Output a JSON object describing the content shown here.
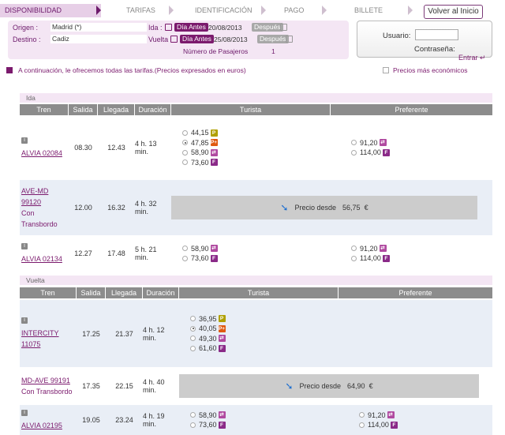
{
  "steps": [
    {
      "label": "DISPONIBILIDAD",
      "active": true
    },
    {
      "label": "TARIFAS",
      "active": false
    },
    {
      "label": "IDENTIFICACIÓN",
      "active": false
    },
    {
      "label": "PAGO",
      "active": false
    },
    {
      "label": "BILLETE",
      "active": false
    }
  ],
  "volver_label": "Volver al Inicio",
  "search": {
    "origen_label": "Origen :",
    "origen_value": "Madrid (*)",
    "destino_label": "Destino :",
    "destino_value": "Cadiz",
    "ida_label": "Ida :",
    "vuelta_label": "Vuelta",
    "dia_antes": "Día Antes",
    "despues": "Después",
    "ida_date": "20/08/2013",
    "vuelta_date": "25/08/2013",
    "pasajeros_label": "Número de Pasajeros",
    "pasajeros_value": "1"
  },
  "login": {
    "usuario_label": "Usuario:",
    "password_label": "Contraseña:",
    "entrar": "Entrar"
  },
  "info_text": "A continuación, le ofrecemos todas las tarifas.(Precios expresados en euros)",
  "econ_label": "Precios más económicos",
  "columns": [
    "Tren",
    "Salida",
    "Llegada",
    "Duración",
    "Turista",
    "Preferente"
  ],
  "colors": {
    "accent": "#7b1a6d",
    "panel": "#f4e6f4",
    "header": "#8c8c8c",
    "alt_row": "#e9eef6"
  },
  "ida": {
    "label": "Ida",
    "rows": [
      {
        "tren": "ALVIA 02084",
        "sub": "",
        "salida": "08.30",
        "llegada": "12.43",
        "duracion": "4 h. 13 min.",
        "turista": [
          {
            "price": "44,15",
            "badge": "P",
            "on": false
          },
          {
            "price": "47,85",
            "badge": "P+",
            "on": true
          },
          {
            "price": "58,90",
            "badge": "F2",
            "on": false
          },
          {
            "price": "73,60",
            "badge": "F",
            "on": false
          }
        ],
        "preferente": [
          {
            "price": "91,20",
            "badge": "F2",
            "on": false
          },
          {
            "price": "114,00",
            "badge": "F",
            "on": false
          }
        ]
      },
      {
        "tren": "AVE-MD 99120",
        "sub": "Con Transbordo",
        "salida": "12.00",
        "llegada": "16.32",
        "duracion": "4 h. 32 min.",
        "precio_label": "Precio desde",
        "precio_value": "56,75",
        "currency": "€"
      },
      {
        "tren": "ALVIA 02134",
        "sub": "",
        "salida": "12.27",
        "llegada": "17.48",
        "duracion": "5 h. 21 min.",
        "turista": [
          {
            "price": "58,90",
            "badge": "F2",
            "on": false
          },
          {
            "price": "73,60",
            "badge": "F",
            "on": false
          }
        ],
        "preferente": [
          {
            "price": "91,20",
            "badge": "F2",
            "on": false
          },
          {
            "price": "114,00",
            "badge": "F",
            "on": false
          }
        ]
      }
    ]
  },
  "vuelta": {
    "label": "Vuelta",
    "rows": [
      {
        "tren": "INTERCITY 11075",
        "sub": "",
        "salida": "17.25",
        "llegada": "21.37",
        "duracion": "4 h. 12 min.",
        "turista": [
          {
            "price": "36,95",
            "badge": "P",
            "on": false
          },
          {
            "price": "40,05",
            "badge": "P+",
            "on": true
          },
          {
            "price": "49,30",
            "badge": "F2",
            "on": false
          },
          {
            "price": "61,60",
            "badge": "F",
            "on": false
          }
        ],
        "preferente": []
      },
      {
        "tren": "MD-AVE 99191",
        "sub": "Con Transbordo",
        "salida": "17.35",
        "llegada": "22.15",
        "duracion": "4 h. 40 min.",
        "precio_label": "Precio desde",
        "precio_value": "64,90",
        "currency": "€"
      },
      {
        "tren": "ALVIA 02195",
        "sub": "",
        "salida": "19.05",
        "llegada": "23.24",
        "duracion": "4 h. 19 min.",
        "turista": [
          {
            "price": "58,90",
            "badge": "F2",
            "on": false
          },
          {
            "price": "73,60",
            "badge": "F",
            "on": false
          }
        ],
        "preferente": [
          {
            "price": "91,20",
            "badge": "F2",
            "on": false
          },
          {
            "price": "114,00",
            "badge": "F",
            "on": false
          }
        ]
      }
    ]
  }
}
